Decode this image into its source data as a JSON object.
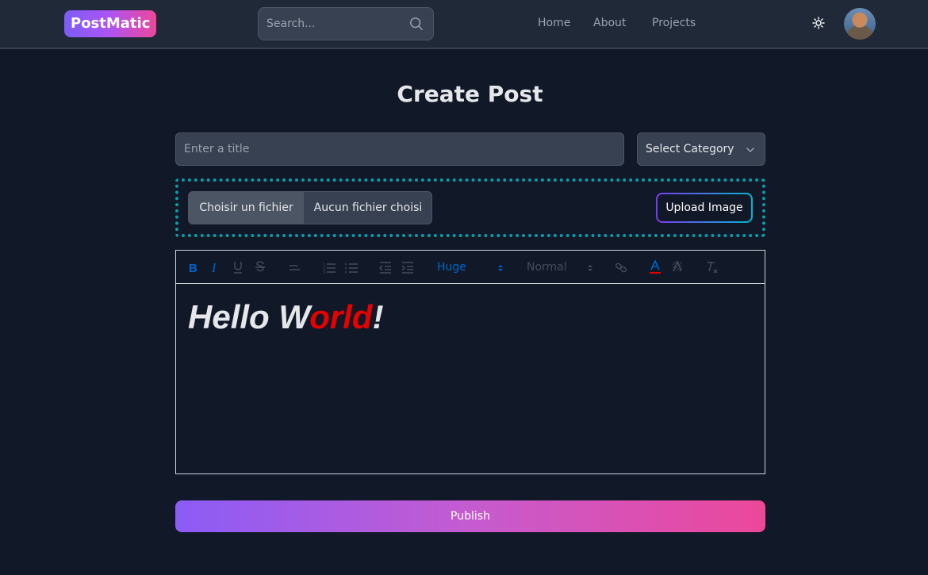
{
  "header": {
    "logo": "PostMatic",
    "search": {
      "placeholder": "Search...",
      "icon": "search-icon"
    },
    "nav": [
      "Home",
      "About",
      "Projects"
    ],
    "theme_icon": "sun-icon",
    "avatar": "user-avatar"
  },
  "main": {
    "title": "Create Post",
    "title_input_placeholder": "Enter a title",
    "category_select": "Select Category",
    "file_button": "Choisir un fichier",
    "file_status": "Aucun fichier choisi",
    "upload_button": "Upload Image",
    "toolbar": {
      "size_select": "Huge",
      "header_select": "Normal",
      "icons": [
        "bold-icon",
        "italic-icon",
        "underline-icon",
        "strike-icon",
        "align-icon",
        "ordered-list-icon",
        "bullet-list-icon",
        "outdent-icon",
        "indent-icon",
        "link-icon",
        "text-color-icon",
        "background-color-icon",
        "clear-format-icon"
      ]
    },
    "content": {
      "part1": "Hello W",
      "part2": "orld",
      "part3": "!"
    },
    "publish_button": "Publish"
  },
  "colors": {
    "background": "#111827",
    "header": "#1f2937",
    "accent_blue": "#0066cc",
    "red_text": "#e60000",
    "dotted_border": "#0e9aa7"
  }
}
